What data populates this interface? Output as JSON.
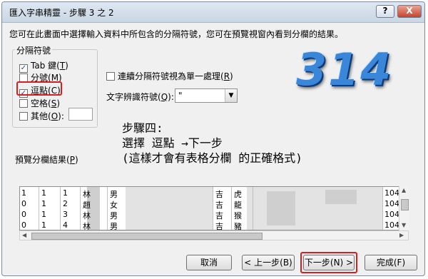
{
  "title": "匯入字串精靈 - 步驟 3 之 2",
  "title_buttons": {
    "help": "?",
    "close": "X"
  },
  "description": "您可在此畫面中選擇輸入資料中所包含的分隔符號，您可在預覽視窗內看到分欄的結果。",
  "delimiters": {
    "legend": "分隔符號",
    "tab": {
      "label": "Tab 鍵(",
      "key": "T",
      "close": ")",
      "checked": true
    },
    "semicolon": {
      "label": "分號(",
      "key": "M",
      "close": ")",
      "checked": false
    },
    "comma": {
      "label": "逗點(",
      "key": "C",
      "close": ")",
      "checked": true
    },
    "space": {
      "label": "空格(",
      "key": "S",
      "close": ")",
      "checked": false
    },
    "other": {
      "label": "其他(",
      "key": "O",
      "close": "):",
      "checked": false,
      "value": ""
    }
  },
  "consecutive": {
    "label": "連續分隔符號視為單一處理(",
    "key": "R",
    "close": ")",
    "checked": false
  },
  "text_qualifier": {
    "label": "文字辨識符號(",
    "key": "Q",
    "close": "):",
    "value": "\""
  },
  "logo_text": "314",
  "annotation": {
    "line1": "步驟四:",
    "line2": "選擇 逗點 →下一步",
    "line3": "(這樣才會有表格分欄 的正確格式)"
  },
  "preview": {
    "label": "預覽分欄結果(",
    "key": "P",
    "close": ")",
    "rows": [
      {
        "c1": "1",
        "c2": "1",
        "c3": "1",
        "c4": "林",
        "c5": "男",
        "c6": "吉",
        "c7": "虎",
        "c8": "104"
      },
      {
        "c1": "0",
        "c2": "1",
        "c3": "2",
        "c4": "趙",
        "c5": "女",
        "c6": "吉",
        "c7": "龍",
        "c8": "104"
      },
      {
        "c1": "0",
        "c2": "1",
        "c3": "3",
        "c4": "林",
        "c5": "男",
        "c6": "吉",
        "c7": "猴",
        "c8": "104"
      },
      {
        "c1": "0",
        "c2": "1",
        "c3": "4",
        "c4": "林",
        "c5": "男",
        "c6": "吉",
        "c7": "豬",
        "c8": "104"
      }
    ]
  },
  "buttons": {
    "cancel": "取消",
    "back": "< 上一步(B)",
    "next": "下一步(N) >",
    "finish": "完成(F)"
  }
}
